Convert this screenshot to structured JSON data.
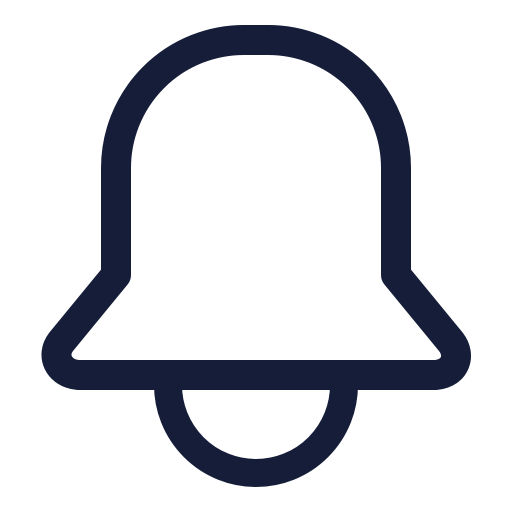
{
  "icon": {
    "name": "bell-icon",
    "stroke_color": "#151d38",
    "fill_color": "#ffffff"
  },
  "background_color": "#ffffff"
}
